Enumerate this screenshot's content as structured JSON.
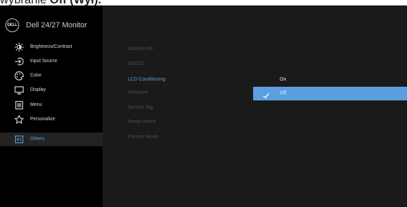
{
  "caption": {
    "prefix": "wybranie ",
    "bold": "Off (Wył)."
  },
  "brand": {
    "logo_text": "DELL",
    "title": "Dell 24/27 Monitor"
  },
  "sidebar": {
    "items": [
      {
        "label": "Brightness/Contrast",
        "icon": "brightness-icon"
      },
      {
        "label": "Input Source",
        "icon": "input-source-icon"
      },
      {
        "label": "Color",
        "icon": "color-icon"
      },
      {
        "label": "Display",
        "icon": "display-icon"
      },
      {
        "label": "Menu",
        "icon": "menu-icon"
      },
      {
        "label": "Personalize",
        "icon": "star-icon"
      },
      {
        "label": "Others",
        "icon": "others-icon",
        "active": true
      }
    ]
  },
  "submenu": {
    "items": [
      {
        "label": "Display Info"
      },
      {
        "label": "DDC/CI"
      },
      {
        "label": "LCD Conditioning",
        "active": true
      },
      {
        "label": "Firmware"
      },
      {
        "label": "Service Tag"
      },
      {
        "label": "Reset Others"
      },
      {
        "label": "Factory Reset"
      }
    ]
  },
  "options": {
    "items": [
      {
        "label": "On",
        "selected": false
      },
      {
        "label": "Off",
        "selected": true
      }
    ]
  },
  "colors": {
    "accent": "#5b9fe0",
    "panel": "#1a1a1a",
    "sidebar": "#000000"
  }
}
